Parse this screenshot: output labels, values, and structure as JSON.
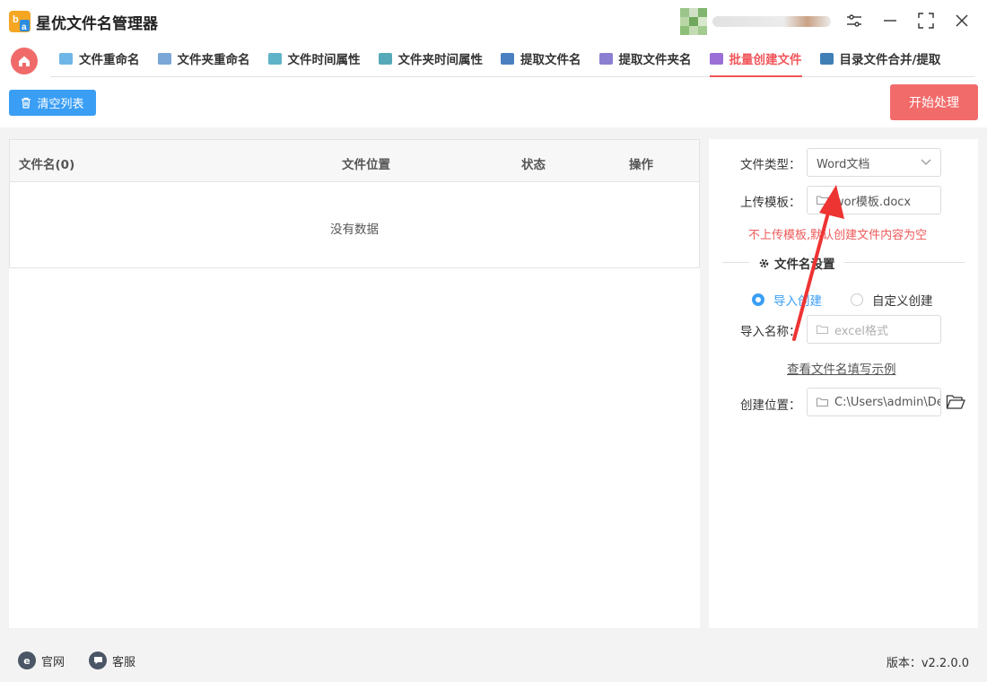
{
  "app": {
    "title": "星优文件名管理器"
  },
  "tabs": [
    {
      "label": "文件重命名",
      "icon": "file-rename-icon",
      "color": "#6fb6e8"
    },
    {
      "label": "文件夹重命名",
      "icon": "folder-rename-icon",
      "color": "#7aa6d8"
    },
    {
      "label": "文件时间属性",
      "icon": "file-time-icon",
      "color": "#5fb3c9"
    },
    {
      "label": "文件夹时间属性",
      "icon": "folder-time-icon",
      "color": "#55a9b8"
    },
    {
      "label": "提取文件名",
      "icon": "extract-filename-icon",
      "color": "#4a7fc1"
    },
    {
      "label": "提取文件夹名",
      "icon": "extract-foldername-icon",
      "color": "#8a7fd0"
    },
    {
      "label": "批量创建文件",
      "icon": "batch-create-icon",
      "color": "#9b6fd6",
      "active": true
    },
    {
      "label": "目录文件合并/提取",
      "icon": "merge-extract-icon",
      "color": "#3f7fb5"
    }
  ],
  "toolbar": {
    "clear_label": "清空列表",
    "start_label": "开始处理"
  },
  "list": {
    "headers": {
      "name": "文件名(0)",
      "location": "文件位置",
      "status": "状态",
      "action": "操作"
    },
    "empty_text": "没有数据"
  },
  "settings": {
    "file_type_label": "文件类型：",
    "file_type_value": "Word文档",
    "template_label": "上传模板：",
    "template_value": "wor模板.docx",
    "template_hint": "不上传模板,默认创建文件内容为空",
    "section_title": "文件名设置",
    "radio_import": "导入创建",
    "radio_custom": "自定义创建",
    "import_name_label": "导入名称：",
    "import_name_placeholder": "excel格式",
    "example_link": "查看文件名填写示例",
    "location_label": "创建位置：",
    "location_value": "C:\\Users\\admin\\Des"
  },
  "footer": {
    "website": "官网",
    "service": "客服",
    "version": "版本：v2.2.0.0"
  },
  "colors": {
    "accent_red": "#f0555a",
    "accent_blue": "#3a9ef5",
    "hint_red": "#ef5a5a"
  }
}
